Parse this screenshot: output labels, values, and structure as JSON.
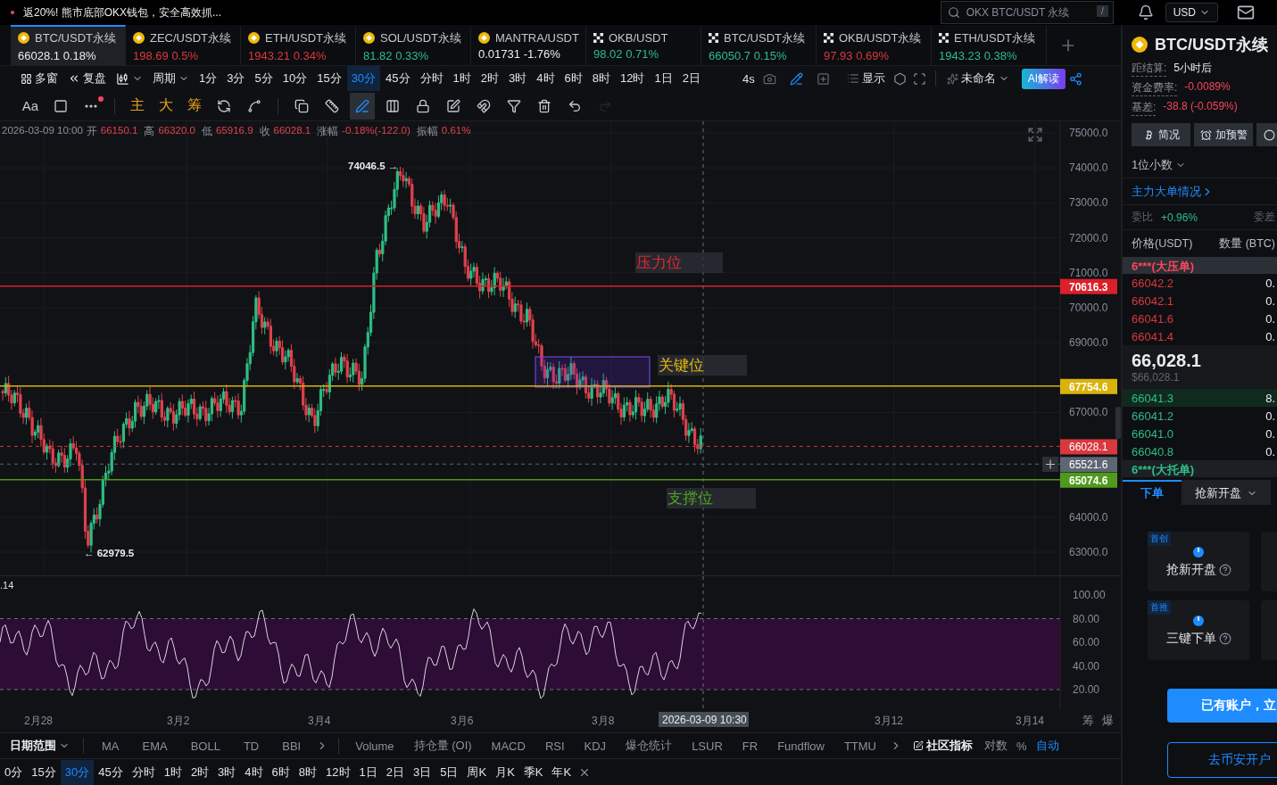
{
  "promo": {
    "text": "返20%! 熊市底部OKX钱包，安全高效抓...",
    "alert": true
  },
  "search": {
    "placeholder": "OKX BTC/USDT 永续",
    "shortcut": "/"
  },
  "currency": {
    "label": "USD"
  },
  "tickers": [
    {
      "name": "BTC/USDT永续",
      "price": "66028.1",
      "change": "0.18%",
      "kind": "binance",
      "color": "#eaecef",
      "selected": true
    },
    {
      "name": "ZEC/USDT永续",
      "price": "198.69",
      "change": "0.5%",
      "kind": "binance",
      "color": "#d8393f",
      "selected": false
    },
    {
      "name": "ETH/USDT永续",
      "price": "1943.21",
      "change": "0.34%",
      "kind": "binance",
      "color": "#d8393f",
      "selected": false
    },
    {
      "name": "SOL/USDT永续",
      "price": "81.82",
      "change": "0.33%",
      "kind": "binance",
      "color": "#2ebd85",
      "selected": false
    },
    {
      "name": "MANTRA/USDT",
      "price": "0.01731",
      "change": "-1.76%",
      "kind": "binance",
      "color": "#eaecef",
      "selected": false
    },
    {
      "name": "OKB/USDT",
      "price": "98.02",
      "change": "0.71%",
      "kind": "okx",
      "color": "#2ebd85",
      "selected": false
    },
    {
      "name": "BTC/USDT永续",
      "price": "66050.7",
      "change": "0.15%",
      "kind": "okx",
      "color": "#2ebd85",
      "selected": false
    },
    {
      "name": "OKB/USDT永续",
      "price": "97.93",
      "change": "0.69%",
      "kind": "okx",
      "color": "#d8393f",
      "selected": false
    },
    {
      "name": "ETH/USDT永续",
      "price": "1943.23",
      "change": "0.38%",
      "kind": "okx",
      "color": "#2ebd85",
      "selected": false
    }
  ],
  "period_toolbar": {
    "view_buttons": [
      {
        "kind": "grid",
        "label": "多窗"
      },
      {
        "kind": "replay",
        "label": "复盘"
      }
    ],
    "period_menu": "周期",
    "periods": [
      {
        "label": "1分",
        "selected": false
      },
      {
        "label": "3分",
        "selected": false
      },
      {
        "label": "5分",
        "selected": false
      },
      {
        "label": "10分",
        "selected": false
      },
      {
        "label": "15分",
        "selected": false
      },
      {
        "label": "30分",
        "selected": true
      },
      {
        "label": "45分",
        "selected": false
      },
      {
        "label": "分时",
        "selected": false
      },
      {
        "label": "1时",
        "selected": false
      },
      {
        "label": "2时",
        "selected": false
      },
      {
        "label": "3时",
        "selected": false
      },
      {
        "label": "4时",
        "selected": false
      },
      {
        "label": "6时",
        "selected": false
      },
      {
        "label": "8时",
        "selected": false
      },
      {
        "label": "12时",
        "selected": false
      },
      {
        "label": "1日",
        "selected": false
      },
      {
        "label": "2日",
        "selected": false
      }
    ],
    "refresh": "4s",
    "display": "显示",
    "layout_name": "未命名",
    "ai_button": "AI解读"
  },
  "drawing_toolbar": {
    "text_tool": "Aa",
    "more_alert": true,
    "shortcuts": [
      "主",
      "大",
      "筹"
    ],
    "tools": [
      {
        "kind": "sync",
        "selected": false,
        "disabled": false
      },
      {
        "kind": "measure",
        "selected": false,
        "disabled": false
      },
      {
        "kind": "copy",
        "selected": false,
        "disabled": false
      },
      {
        "kind": "ruler",
        "selected": false,
        "disabled": false
      },
      {
        "kind": "pen",
        "selected": true,
        "disabled": false
      },
      {
        "kind": "candles",
        "selected": false,
        "disabled": false
      },
      {
        "kind": "lock",
        "selected": false,
        "disabled": false
      },
      {
        "kind": "note",
        "selected": false,
        "disabled": false
      },
      {
        "kind": "magnet",
        "selected": false,
        "disabled": false
      },
      {
        "kind": "filter",
        "selected": false,
        "disabled": false
      },
      {
        "kind": "trash",
        "selected": false,
        "disabled": false
      },
      {
        "kind": "undo",
        "selected": false,
        "disabled": false
      },
      {
        "kind": "redo",
        "selected": false,
        "disabled": true
      }
    ]
  },
  "chart": {
    "ohlc": {
      "time": "2026-03-09 10:00",
      "fields": [
        {
          "label": "开",
          "value": "66150.1"
        },
        {
          "label": "高",
          "value": "66320.0"
        },
        {
          "label": "低",
          "value": "65916.9"
        },
        {
          "label": "收",
          "value": "66028.1"
        },
        {
          "label": "涨幅",
          "value": "-0.18%(-122.0)"
        },
        {
          "label": "振幅",
          "value": "0.61%"
        }
      ]
    },
    "price_ticks": [
      "75000.0",
      "74000.0",
      "73000.0",
      "72000.0",
      "71000.0",
      "70000.0",
      "69000.0",
      "67000.0",
      "64000.0",
      "63000.0"
    ],
    "price_lines": [
      {
        "label": "70616.3",
        "color": "#d9202b",
        "kind": "solid"
      },
      {
        "label": "67754.6",
        "color": "#d9b20a",
        "kind": "solid"
      },
      {
        "label": "66028.1",
        "color": "#d8393f",
        "kind": "dashed"
      },
      {
        "label": "65521.6",
        "color": "#5e6673",
        "kind": "dashed"
      },
      {
        "label": "65074.6",
        "color": "#4f9a1c",
        "kind": "solid"
      }
    ],
    "zones": [
      {
        "label": "压力位",
        "color": "#e8262f"
      },
      {
        "label": "关键位",
        "color": "#e7b80d"
      },
      {
        "label": "支撑位",
        "color": "#52a51f"
      }
    ],
    "high_marker": "74046.5 →",
    "low_marker": "← 62979.5"
  },
  "indicator": {
    "value_label": ".14",
    "ticks": [
      "100.00",
      "80.00",
      "60.00",
      "40.00",
      "20.00"
    ]
  },
  "time_axis": {
    "labels": [
      "2月28",
      "3月2",
      "3月4",
      "3月6",
      "3月8",
      "3月12",
      "3月14"
    ],
    "crosshair_time": "2026-03-09 10:30",
    "buttons": [
      "筹",
      "爆"
    ]
  },
  "indicator_bar": {
    "range_menu": "日期范围",
    "main_indicators": [
      "MA",
      "EMA",
      "BOLL",
      "TD",
      "BBI"
    ],
    "sub_indicators": [
      "Volume",
      "持仓量 (OI)",
      "MACD",
      "RSI",
      "KDJ",
      "爆仓统计",
      "LSUR",
      "FR",
      "Fundflow",
      "TTMU"
    ],
    "community": "社区指标",
    "scale_options": [
      {
        "label": "对数",
        "selected": false
      },
      {
        "label": "%",
        "selected": false
      },
      {
        "label": "自动",
        "selected": true
      }
    ]
  },
  "bottom_periods": [
    {
      "label": "0分",
      "selected": false
    },
    {
      "label": "15分",
      "selected": false
    },
    {
      "label": "30分",
      "selected": true
    },
    {
      "label": "45分",
      "selected": false
    },
    {
      "label": "分时",
      "selected": false
    },
    {
      "label": "1时",
      "selected": false
    },
    {
      "label": "2时",
      "selected": false
    },
    {
      "label": "3时",
      "selected": false
    },
    {
      "label": "4时",
      "selected": false
    },
    {
      "label": "6时",
      "selected": false
    },
    {
      "label": "8时",
      "selected": false
    },
    {
      "label": "12时",
      "selected": false
    },
    {
      "label": "1日",
      "selected": false
    },
    {
      "label": "2日",
      "selected": false
    },
    {
      "label": "3日",
      "selected": false
    },
    {
      "label": "5日",
      "selected": false
    },
    {
      "label": "周K",
      "selected": false
    },
    {
      "label": "月K",
      "selected": false
    },
    {
      "label": "季K",
      "selected": false
    },
    {
      "label": "年K",
      "selected": false
    }
  ],
  "side_panel": {
    "title": "BTC/USDT永续",
    "stats": [
      {
        "label": "距结算:",
        "value": "5小时后",
        "color": "#eaecef"
      },
      {
        "label": "资金费率:",
        "value": "-0.0089%",
        "color": "#f6465d"
      },
      {
        "label": "基差:",
        "value": "-38.8 (-0.059%)",
        "color": "#f6465d"
      }
    ],
    "buttons": [
      {
        "kind": "info",
        "label": "简况"
      },
      {
        "kind": "alarm",
        "label": "加预警"
      },
      {
        "kind": "more"
      }
    ],
    "decimals": "1位小数",
    "big_orders_link": "主力大单情况",
    "ratio": {
      "label": "委比",
      "value": "+0.96%"
    },
    "diff_label": "委差",
    "book_header": {
      "price": "价格(USDT)",
      "amount": "数量 (BTC)"
    },
    "ask_wall": "6***(大压单)",
    "asks": [
      {
        "price": "66042.2",
        "amount": "0."
      },
      {
        "price": "66042.1",
        "amount": "0."
      },
      {
        "price": "66041.6",
        "amount": "0."
      },
      {
        "price": "66041.4",
        "amount": "0."
      }
    ],
    "last_price": "66,028.1",
    "last_price_usd": "$66,028.1",
    "bids": [
      {
        "price": "66041.3",
        "amount": "8."
      },
      {
        "price": "66041.2",
        "amount": "0."
      },
      {
        "price": "66041.0",
        "amount": "0."
      },
      {
        "price": "66040.8",
        "amount": "0."
      }
    ],
    "bid_wall": "6***(大托单)",
    "order_tabs": [
      {
        "label": "下单",
        "selected": true,
        "menu": false
      },
      {
        "label": "抢新开盘",
        "selected": false,
        "menu": true
      }
    ],
    "feature_cards": [
      {
        "badge": "首创",
        "label": "抢新开盘"
      },
      {
        "badge": "首推",
        "label": "三键下单"
      }
    ],
    "login_button": "已有账户，立",
    "signup_button": "去币安开户"
  }
}
